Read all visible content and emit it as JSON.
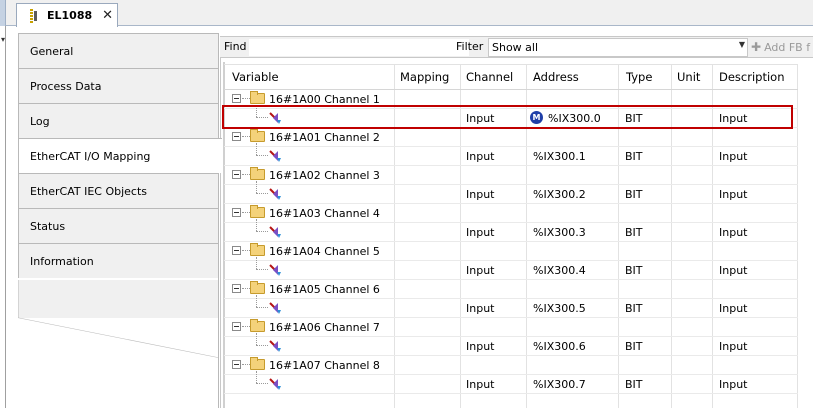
{
  "tab": {
    "title": "EL1088",
    "close": "✕"
  },
  "nav": [
    {
      "label": "General"
    },
    {
      "label": "Process Data"
    },
    {
      "label": "Log"
    },
    {
      "label": "EtherCAT I/O Mapping"
    },
    {
      "label": "EtherCAT IEC Objects"
    },
    {
      "label": "Status"
    },
    {
      "label": "Information"
    }
  ],
  "toolbar": {
    "find_label": "Find",
    "find_value": "",
    "filter_label": "Filter",
    "filter_value": "Show all",
    "add_fb_label": "Add FB f"
  },
  "table": {
    "columns": [
      "Variable",
      "Mapping",
      "Channel",
      "Address",
      "Type",
      "Unit",
      "Description"
    ],
    "groups": [
      {
        "name": "16#1A00 Channel 1",
        "channel": "Input",
        "address": "%IX300.0",
        "type": "BIT",
        "description": "Input",
        "mapped": true
      },
      {
        "name": "16#1A01 Channel 2",
        "channel": "Input",
        "address": "%IX300.1",
        "type": "BIT",
        "description": "Input",
        "mapped": false
      },
      {
        "name": "16#1A02 Channel 3",
        "channel": "Input",
        "address": "%IX300.2",
        "type": "BIT",
        "description": "Input",
        "mapped": false
      },
      {
        "name": "16#1A03 Channel 4",
        "channel": "Input",
        "address": "%IX300.3",
        "type": "BIT",
        "description": "Input",
        "mapped": false
      },
      {
        "name": "16#1A04 Channel 5",
        "channel": "Input",
        "address": "%IX300.4",
        "type": "BIT",
        "description": "Input",
        "mapped": false
      },
      {
        "name": "16#1A05 Channel 6",
        "channel": "Input",
        "address": "%IX300.5",
        "type": "BIT",
        "description": "Input",
        "mapped": false
      },
      {
        "name": "16#1A06 Channel 7",
        "channel": "Input",
        "address": "%IX300.6",
        "type": "BIT",
        "description": "Input",
        "mapped": false
      },
      {
        "name": "16#1A07 Channel 8",
        "channel": "Input",
        "address": "%IX300.7",
        "type": "BIT",
        "description": "Input",
        "mapped": false
      }
    ]
  },
  "mapped_badge": "M",
  "colors": {
    "highlight": "#c00000",
    "mapped_badge": "#1f3fa8",
    "folder": "#f4d27a"
  }
}
